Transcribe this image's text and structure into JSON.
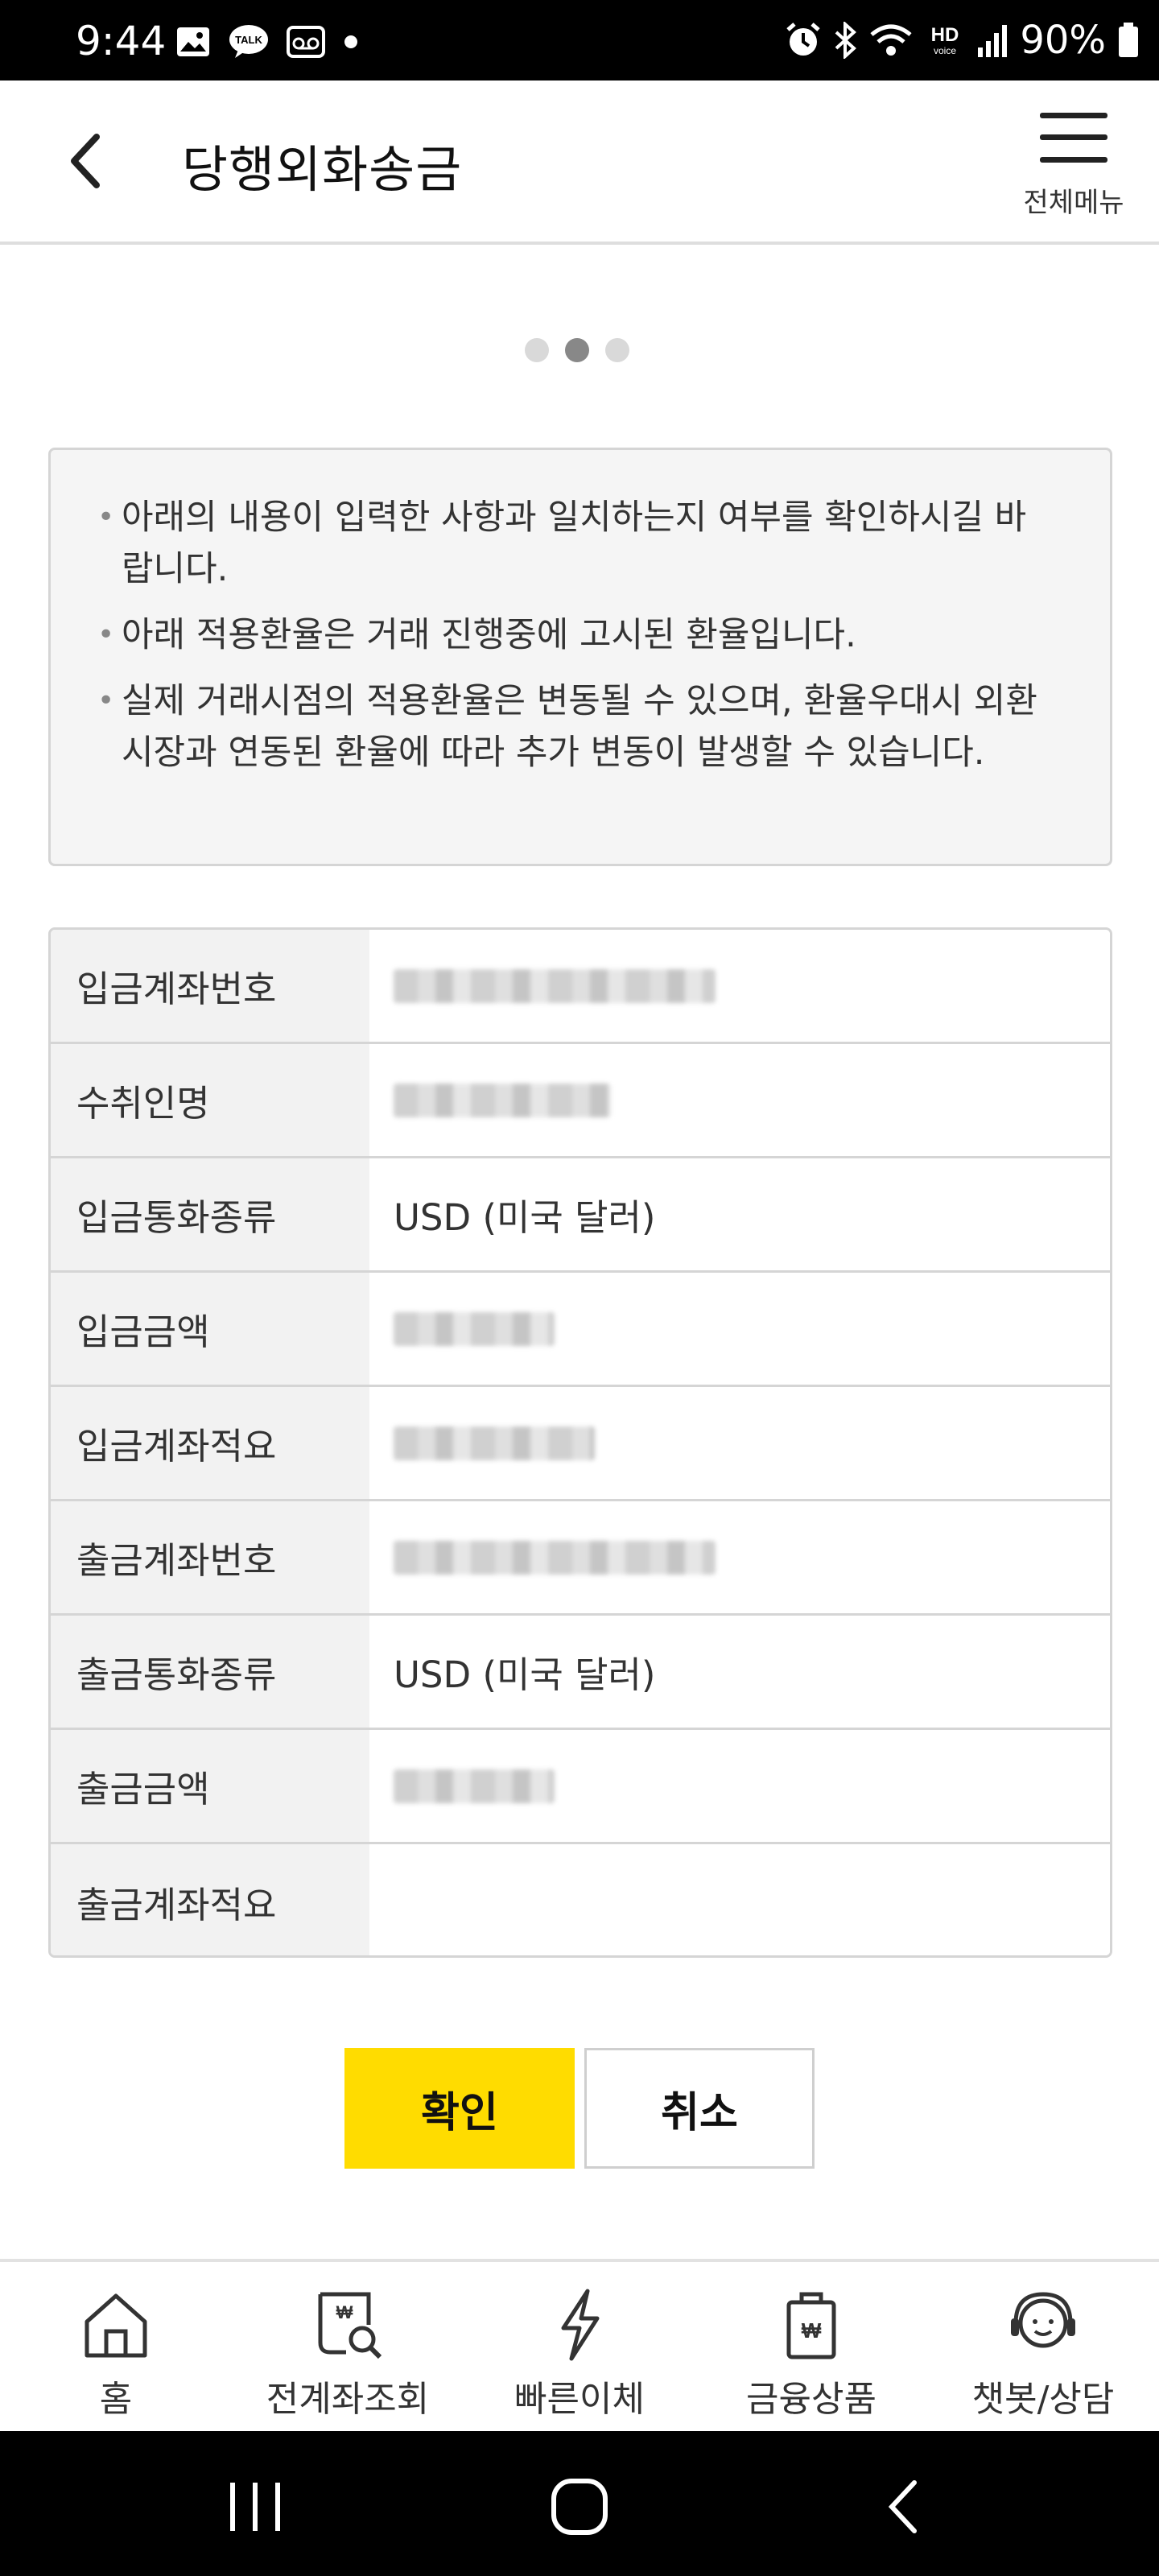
{
  "status_bar": {
    "time": "9:44",
    "notification_icons": [
      "gallery-icon",
      "kakaotalk-icon",
      "voicemail-icon",
      "dot-icon"
    ],
    "right_icons": [
      "alarm-icon",
      "bluetooth-icon",
      "wifi-icon",
      "hd-voice-icon",
      "signal-icon",
      "battery-icon"
    ],
    "battery": "90%"
  },
  "header": {
    "title": "당행외화송금",
    "menu_label": "전체메뉴"
  },
  "steps": {
    "count": 3,
    "active_index": 1
  },
  "notices": [
    "아래의 내용이 입력한 사항과 일치하는지 여부를 확인하시길 바랍니다.",
    "아래 적용환율은 거래 진행중에 고시된 환율입니다.",
    "실제 거래시점의 적용환율은 변동될 수 있으며, 환율우대시 외환시장과 연동된 환율에 따라 추가 변동이 발생할 수 있습니다."
  ],
  "table": [
    {
      "label": "입금계좌번호",
      "value": "",
      "blurred": true
    },
    {
      "label": "수취인명",
      "value": "",
      "blurred": true
    },
    {
      "label": "입금통화종류",
      "value": "USD (미국 달러)",
      "blurred": false
    },
    {
      "label": "입금금액",
      "value": "",
      "blurred": true
    },
    {
      "label": "입금계좌적요",
      "value": "",
      "blurred": true
    },
    {
      "label": "출금계좌번호",
      "value": "",
      "blurred": true
    },
    {
      "label": "출금통화종류",
      "value": "USD (미국 달러)",
      "blurred": false
    },
    {
      "label": "출금금액",
      "value": "",
      "blurred": true
    },
    {
      "label": "출금계좌적요",
      "value": "",
      "blurred": false
    }
  ],
  "buttons": {
    "confirm": "확인",
    "cancel": "취소"
  },
  "bottom_nav": [
    {
      "label": "홈",
      "icon": "home-icon"
    },
    {
      "label": "전계좌조회",
      "icon": "account-search-icon"
    },
    {
      "label": "빠른이체",
      "icon": "lightning-icon"
    },
    {
      "label": "금융상품",
      "icon": "product-bag-icon"
    },
    {
      "label": "챗봇/상담",
      "icon": "chatbot-icon"
    }
  ],
  "colors": {
    "accent": "#ffdc00",
    "border": "#d5d5d5",
    "label_bg": "#f2f2f2"
  }
}
